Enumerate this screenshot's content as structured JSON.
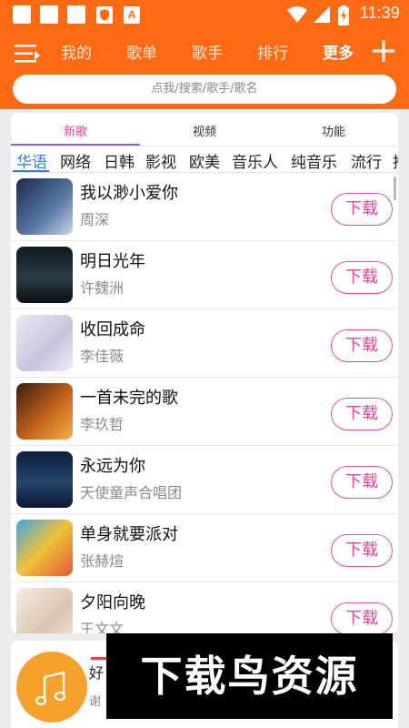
{
  "status_bar": {
    "time": "11:39",
    "indicator_letter": "A"
  },
  "nav": {
    "items": [
      "我的",
      "歌单",
      "歌手",
      "排行",
      "更多"
    ],
    "active_index": 4
  },
  "search": {
    "placeholder": "点我/搜索/歌手/歌名"
  },
  "tabs": [
    {
      "label": "新歌",
      "active": true
    },
    {
      "label": "视频",
      "active": false
    },
    {
      "label": "功能",
      "active": false
    }
  ],
  "categories": [
    "华语",
    "网络",
    "日韩",
    "影视",
    "欧美",
    "音乐人",
    "纯音乐",
    "流行",
    "推"
  ],
  "active_category": 0,
  "download_label": "下载",
  "songs": [
    {
      "title": "我以渺小爱你",
      "artist": "周深"
    },
    {
      "title": "明日光年",
      "artist": "许魏洲"
    },
    {
      "title": "收回成命",
      "artist": "李佳薇"
    },
    {
      "title": "一首未完的歌",
      "artist": "李玖哲"
    },
    {
      "title": "永远为你",
      "artist": "天使童声合唱团"
    },
    {
      "title": "单身就要派对",
      "artist": "张赫煊"
    },
    {
      "title": "夕阳向晚",
      "artist": "王文文"
    }
  ],
  "player": {
    "title": "好",
    "subtitle": "谢"
  },
  "watermark": {
    "text": "下载鸟资源"
  },
  "colors": {
    "accent": "#ff6a13",
    "download": "#e0479a",
    "category_active": "#3a7bd5"
  }
}
